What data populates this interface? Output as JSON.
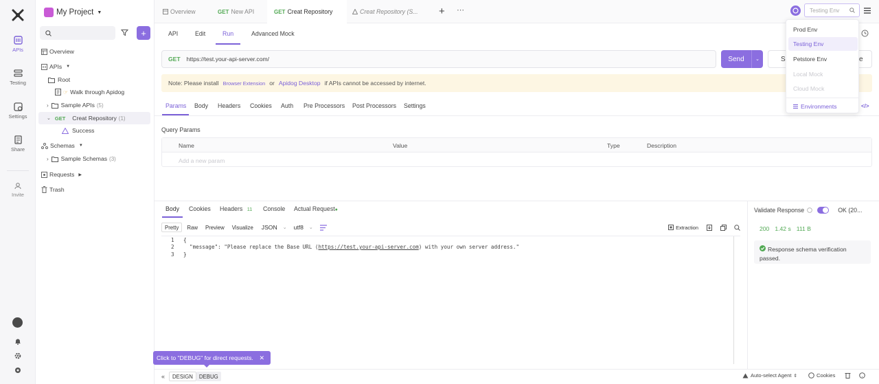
{
  "project": {
    "name": "My Project"
  },
  "rail": [
    {
      "label": "APIs",
      "icon": "apis-icon"
    },
    {
      "label": "Testing",
      "icon": "testing-icon"
    },
    {
      "label": "Settings",
      "icon": "settings-icon"
    },
    {
      "label": "Share",
      "icon": "share-icon"
    },
    {
      "label": "Invite",
      "icon": "invite-icon"
    }
  ],
  "sidebar": {
    "search_placeholder": "",
    "tree": {
      "overview": "Overview",
      "apis": "APIs",
      "root": "Root",
      "walkthrough": "Walk through Apidog",
      "sample_apis": "Sample APIs",
      "sample_apis_count": "(5)",
      "creat_repo_method": "GET",
      "creat_repo": "Creat Repository",
      "creat_repo_count": "(1)",
      "success": "Success",
      "schemas": "Schemas",
      "sample_schemas": "Sample Schemas",
      "sample_schemas_count": "(3)",
      "requests": "Requests",
      "trash": "Trash"
    }
  },
  "tabs": [
    {
      "label": "Overview",
      "method": ""
    },
    {
      "label": "New API",
      "method": "GET"
    },
    {
      "label": "Creat Repository",
      "method": "GET"
    },
    {
      "label": "Creat Repository (S...",
      "method": ""
    }
  ],
  "env": {
    "selected": "Testing Env"
  },
  "dropdown": {
    "items": [
      "Prod Env",
      "Testing Env",
      "Petstore Env",
      "Local Mock",
      "Cloud Mock"
    ],
    "footer": "Environments"
  },
  "subtabs": [
    "API",
    "Edit",
    "Run",
    "Advanced Mock"
  ],
  "request": {
    "method": "GET",
    "url": "https://test.your-api-server.com/",
    "send": "Send",
    "save_partial_left": "S",
    "save_partial_right": "e"
  },
  "note": {
    "prefix": "Note: Please install",
    "ext": "Browser Extension",
    "or": "or",
    "desktop": "Apidog Desktop",
    "suffix": "if APIs cannot be accessed by internet."
  },
  "param_tabs": [
    "Params",
    "Body",
    "Headers",
    "Cookies",
    "Auth",
    "Pre Processors",
    "Post Processors",
    "Settings"
  ],
  "query": {
    "title": "Query Params",
    "columns": [
      "Name",
      "Value",
      "Type",
      "Description"
    ],
    "add_placeholder": "Add a new param"
  },
  "response": {
    "tabs": [
      "Body",
      "Cookies",
      "Headers",
      "Console",
      "Actual Request"
    ],
    "headers_count": "11",
    "formats": [
      "Pretty",
      "Raw",
      "Preview",
      "Visualize"
    ],
    "lang": "JSON",
    "encoding": "utf8",
    "extraction": "Extraction",
    "code_lines": [
      "1",
      "2",
      "3"
    ],
    "code_key": "\"message\"",
    "code_value_pre": "\"Please replace the Base URL (",
    "code_link": "https://test.your-api-server.com",
    "code_value_post": ") with your own server address.\""
  },
  "validate": {
    "label": "Validate Response",
    "status_text": "OK (20...",
    "code": "200",
    "time": "1.42 s",
    "size": "111 B",
    "passed": "Response schema verification passed."
  },
  "tooltip": "Click to \"DEBUG\" for direct requests.",
  "footer": {
    "design": "DESIGN",
    "debug": "DEBUG",
    "agent": "Auto-select Agent",
    "cookies": "Cookies"
  },
  "colors": {
    "accent": "#7b61d8",
    "send": "#8b6ee0",
    "get": "#52a954",
    "note_bg": "#fdf6e3"
  }
}
